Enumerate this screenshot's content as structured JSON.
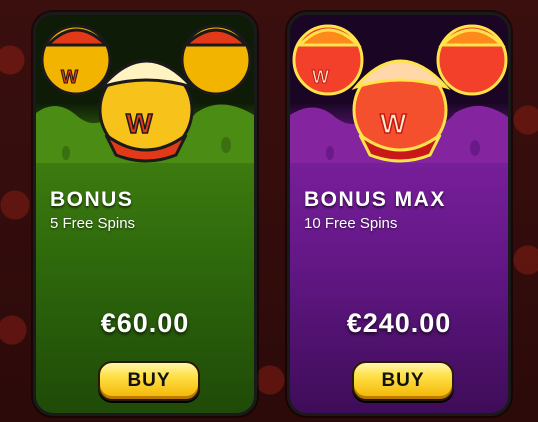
{
  "cards": [
    {
      "title": "BONUS",
      "subtitle": "5 Free Spins",
      "price": "€60.00",
      "buy_label": "BUY",
      "theme_color": "#3f7d10",
      "mascot_style": "gold-mascots"
    },
    {
      "title": "BONUS MAX",
      "subtitle": "10 Free Spins",
      "price": "€240.00",
      "buy_label": "BUY",
      "theme_color": "#7a1f9c",
      "mascot_style": "red-mascots"
    }
  ],
  "colors": {
    "button": "#ffd21f",
    "background": "#2c0a0a"
  }
}
